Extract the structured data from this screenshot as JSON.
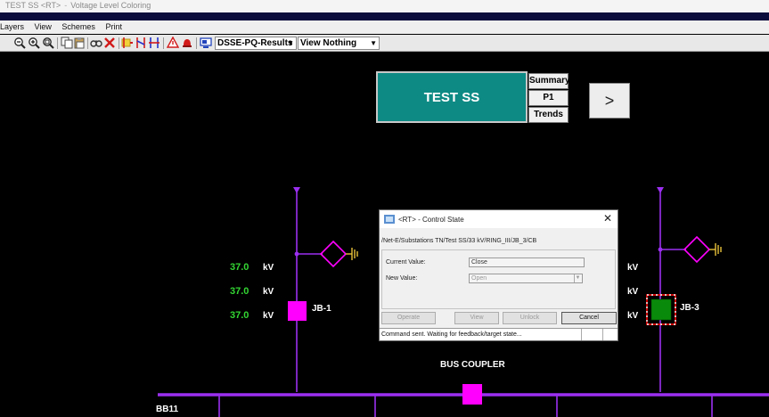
{
  "window": {
    "title_parts": [
      "TEST SS <RT>",
      "Voltage Level Coloring"
    ]
  },
  "menu": [
    "Layers",
    "View",
    "Schemes",
    "Print"
  ],
  "toolbar": {
    "icons": [
      "zoom-out-icon",
      "zoom-in-icon",
      "zoom-fit-icon",
      "copy-icon",
      "paste-icon",
      "find-icon",
      "delete-icon",
      "tag-icon",
      "switch-icon",
      "breaker-icon",
      "alarm-icon",
      "bell-icon",
      "screen-icon"
    ],
    "results_select": "DSSE-PQ-Results",
    "view_select": "View Nothing"
  },
  "diagram": {
    "station_button": "TEST SS",
    "side_buttons": [
      "Summary",
      "P1",
      "Trends"
    ],
    "next_button": ">",
    "left_measurements": [
      {
        "value": "37.0",
        "unit": "kV"
      },
      {
        "value": "37.0",
        "unit": "kV"
      },
      {
        "value": "37.0",
        "unit": "kV"
      }
    ],
    "right_units": [
      "kV",
      "kV",
      "kV"
    ],
    "jb1_label": "JB-1",
    "jb3_label": "JB-3",
    "bus_coupler_label": "BUS COUPLER",
    "busbar_label": "BB11",
    "colors": {
      "bay_line": "#9b2ff0",
      "device": "#ff00ff",
      "measurement": "#33d633",
      "breaker_closed": "#0a8a0a",
      "selection": "#ff0000",
      "ground": "#e8c13a"
    }
  },
  "dialog": {
    "title": "<RT> - Control State",
    "path": "/Net-E/Substations TN/Test SS/33 kV/RING_III/JB_3/CB",
    "current_value_label": "Current Value:",
    "current_value": "Close",
    "new_value_label": "New Value:",
    "new_value": "Open",
    "buttons": {
      "operate": "Operate",
      "view": "View",
      "unlock": "Unlock",
      "cancel": "Cancel"
    },
    "status": "Command sent. Waiting for feedback/target state..."
  }
}
